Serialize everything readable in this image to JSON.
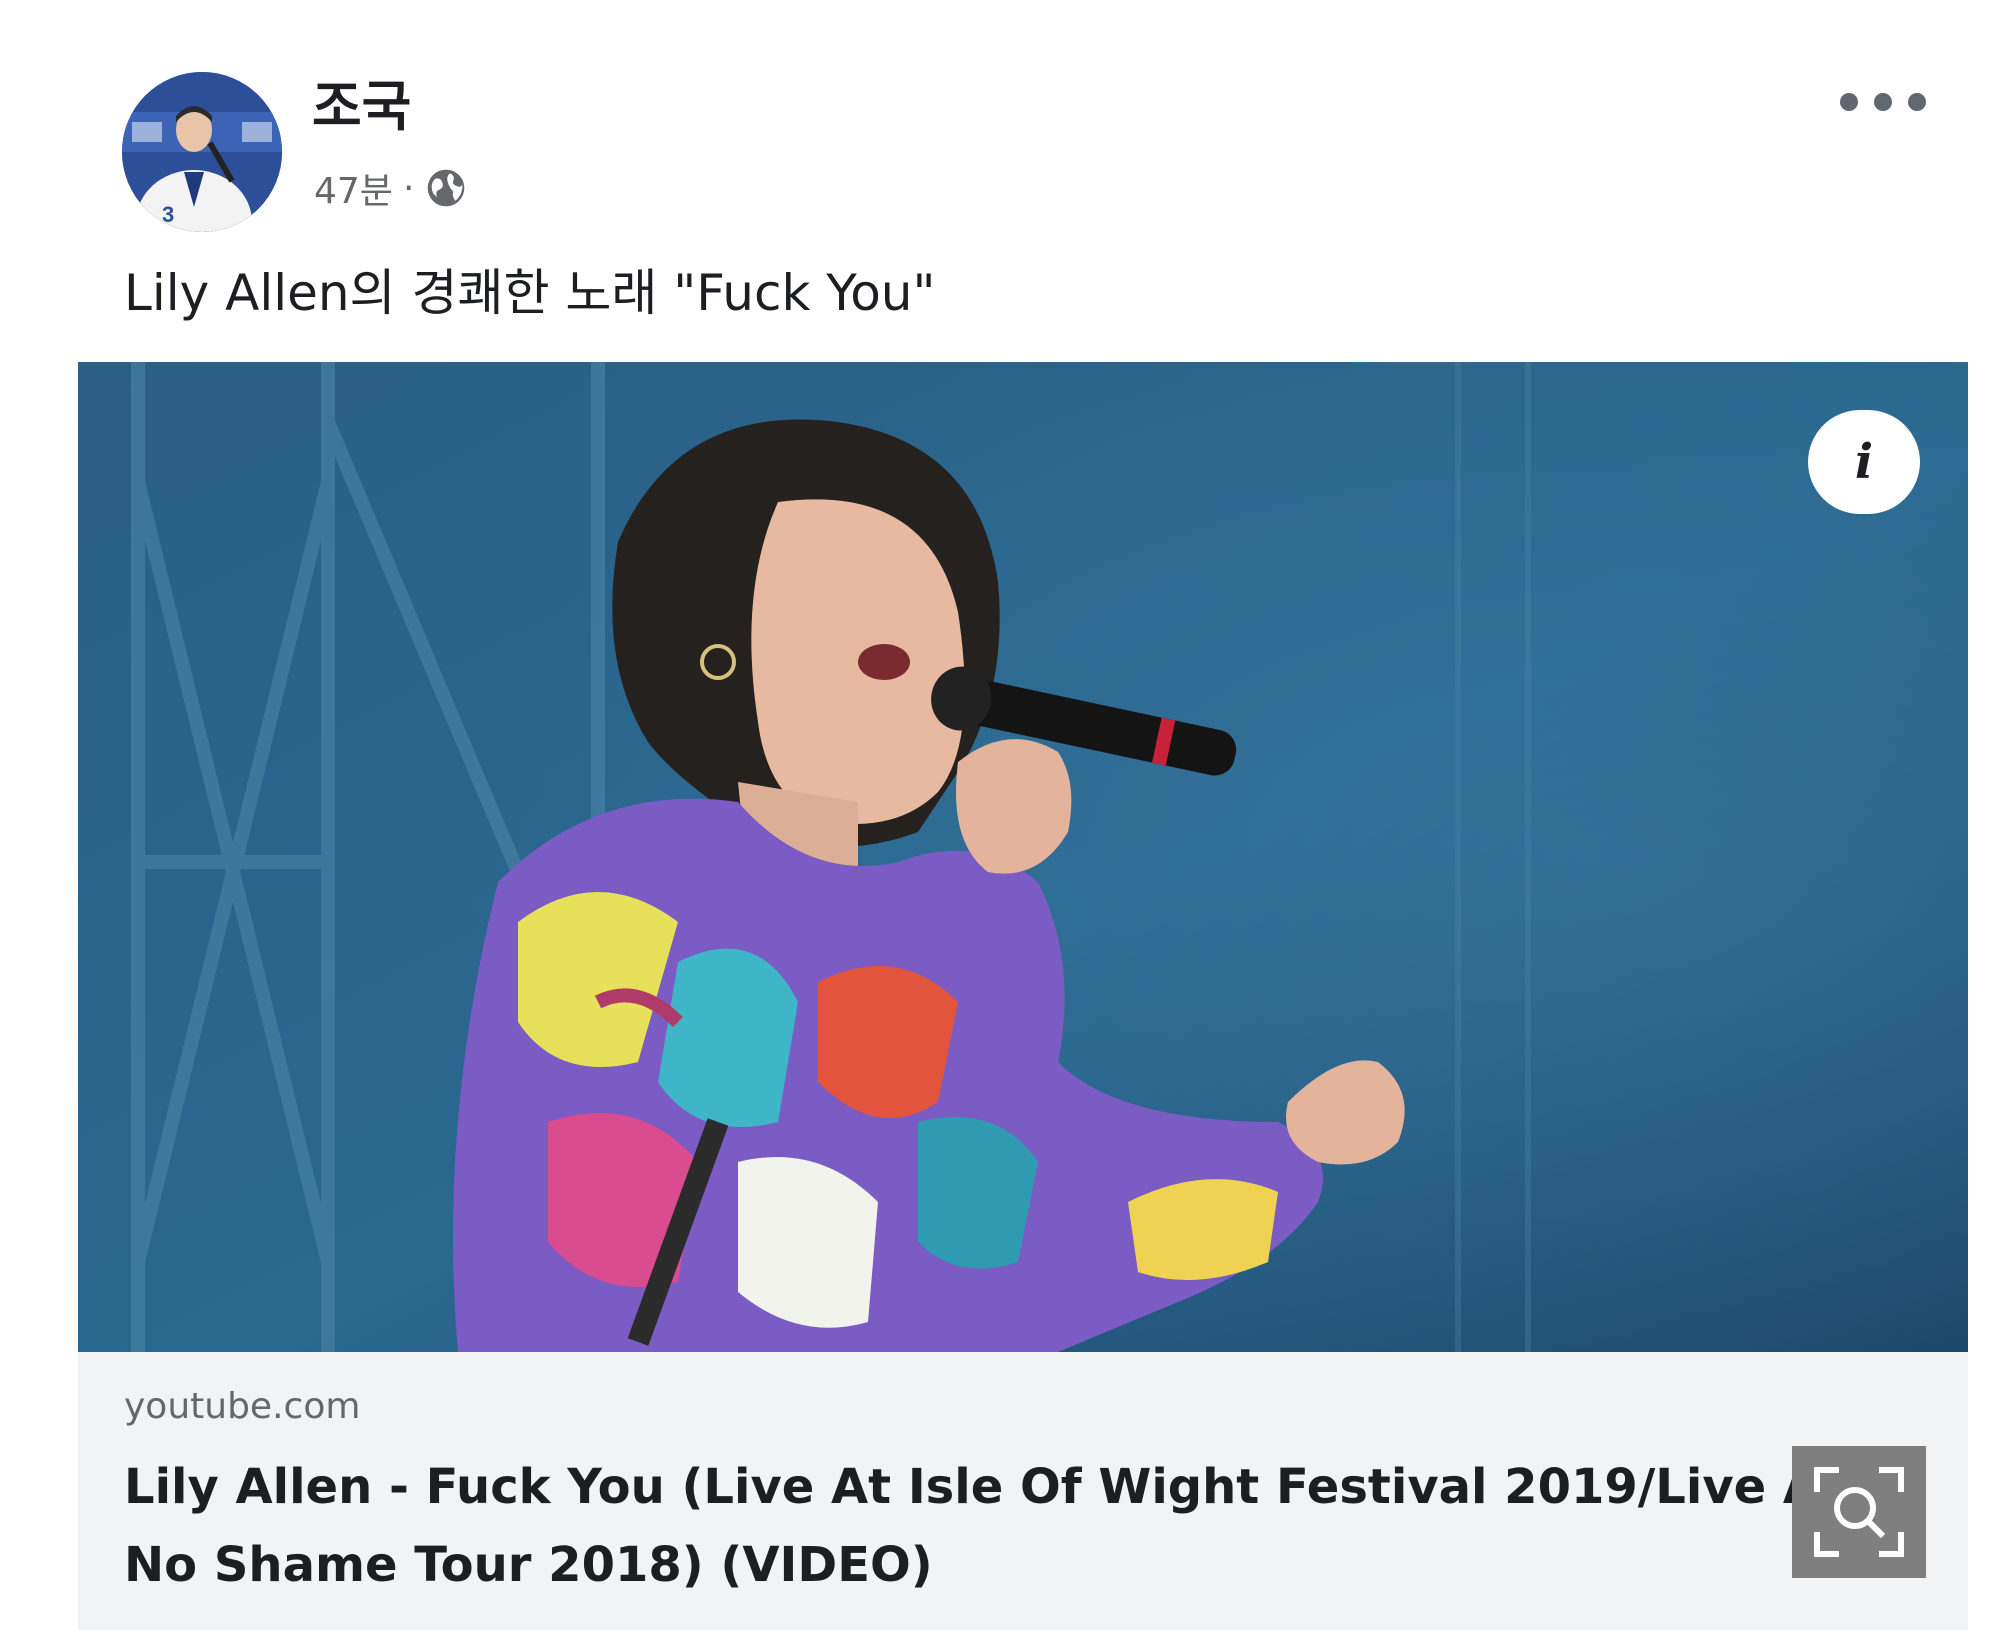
{
  "post": {
    "author": "조국",
    "time": "47분",
    "separator": "·",
    "audience_icon": "globe-icon",
    "menu_icon": "more-horizontal-icon",
    "text": "Lily Allen의 경쾌한 노래 \"Fuck You\""
  },
  "link_preview": {
    "info_icon": "info-icon",
    "info_label": "i",
    "domain": "youtube.com",
    "title": "Lily Allen - Fuck You (Live At Isle Of Wight Festival 2019/Live At No Shame Tour 2018) (VIDEO)",
    "lens_icon": "visual-search-icon"
  },
  "colors": {
    "text_primary": "#1c1e21",
    "text_secondary": "#65676b",
    "card_footer_bg": "#f2f3f5",
    "thumbnail_sky": "#1f4d74"
  }
}
